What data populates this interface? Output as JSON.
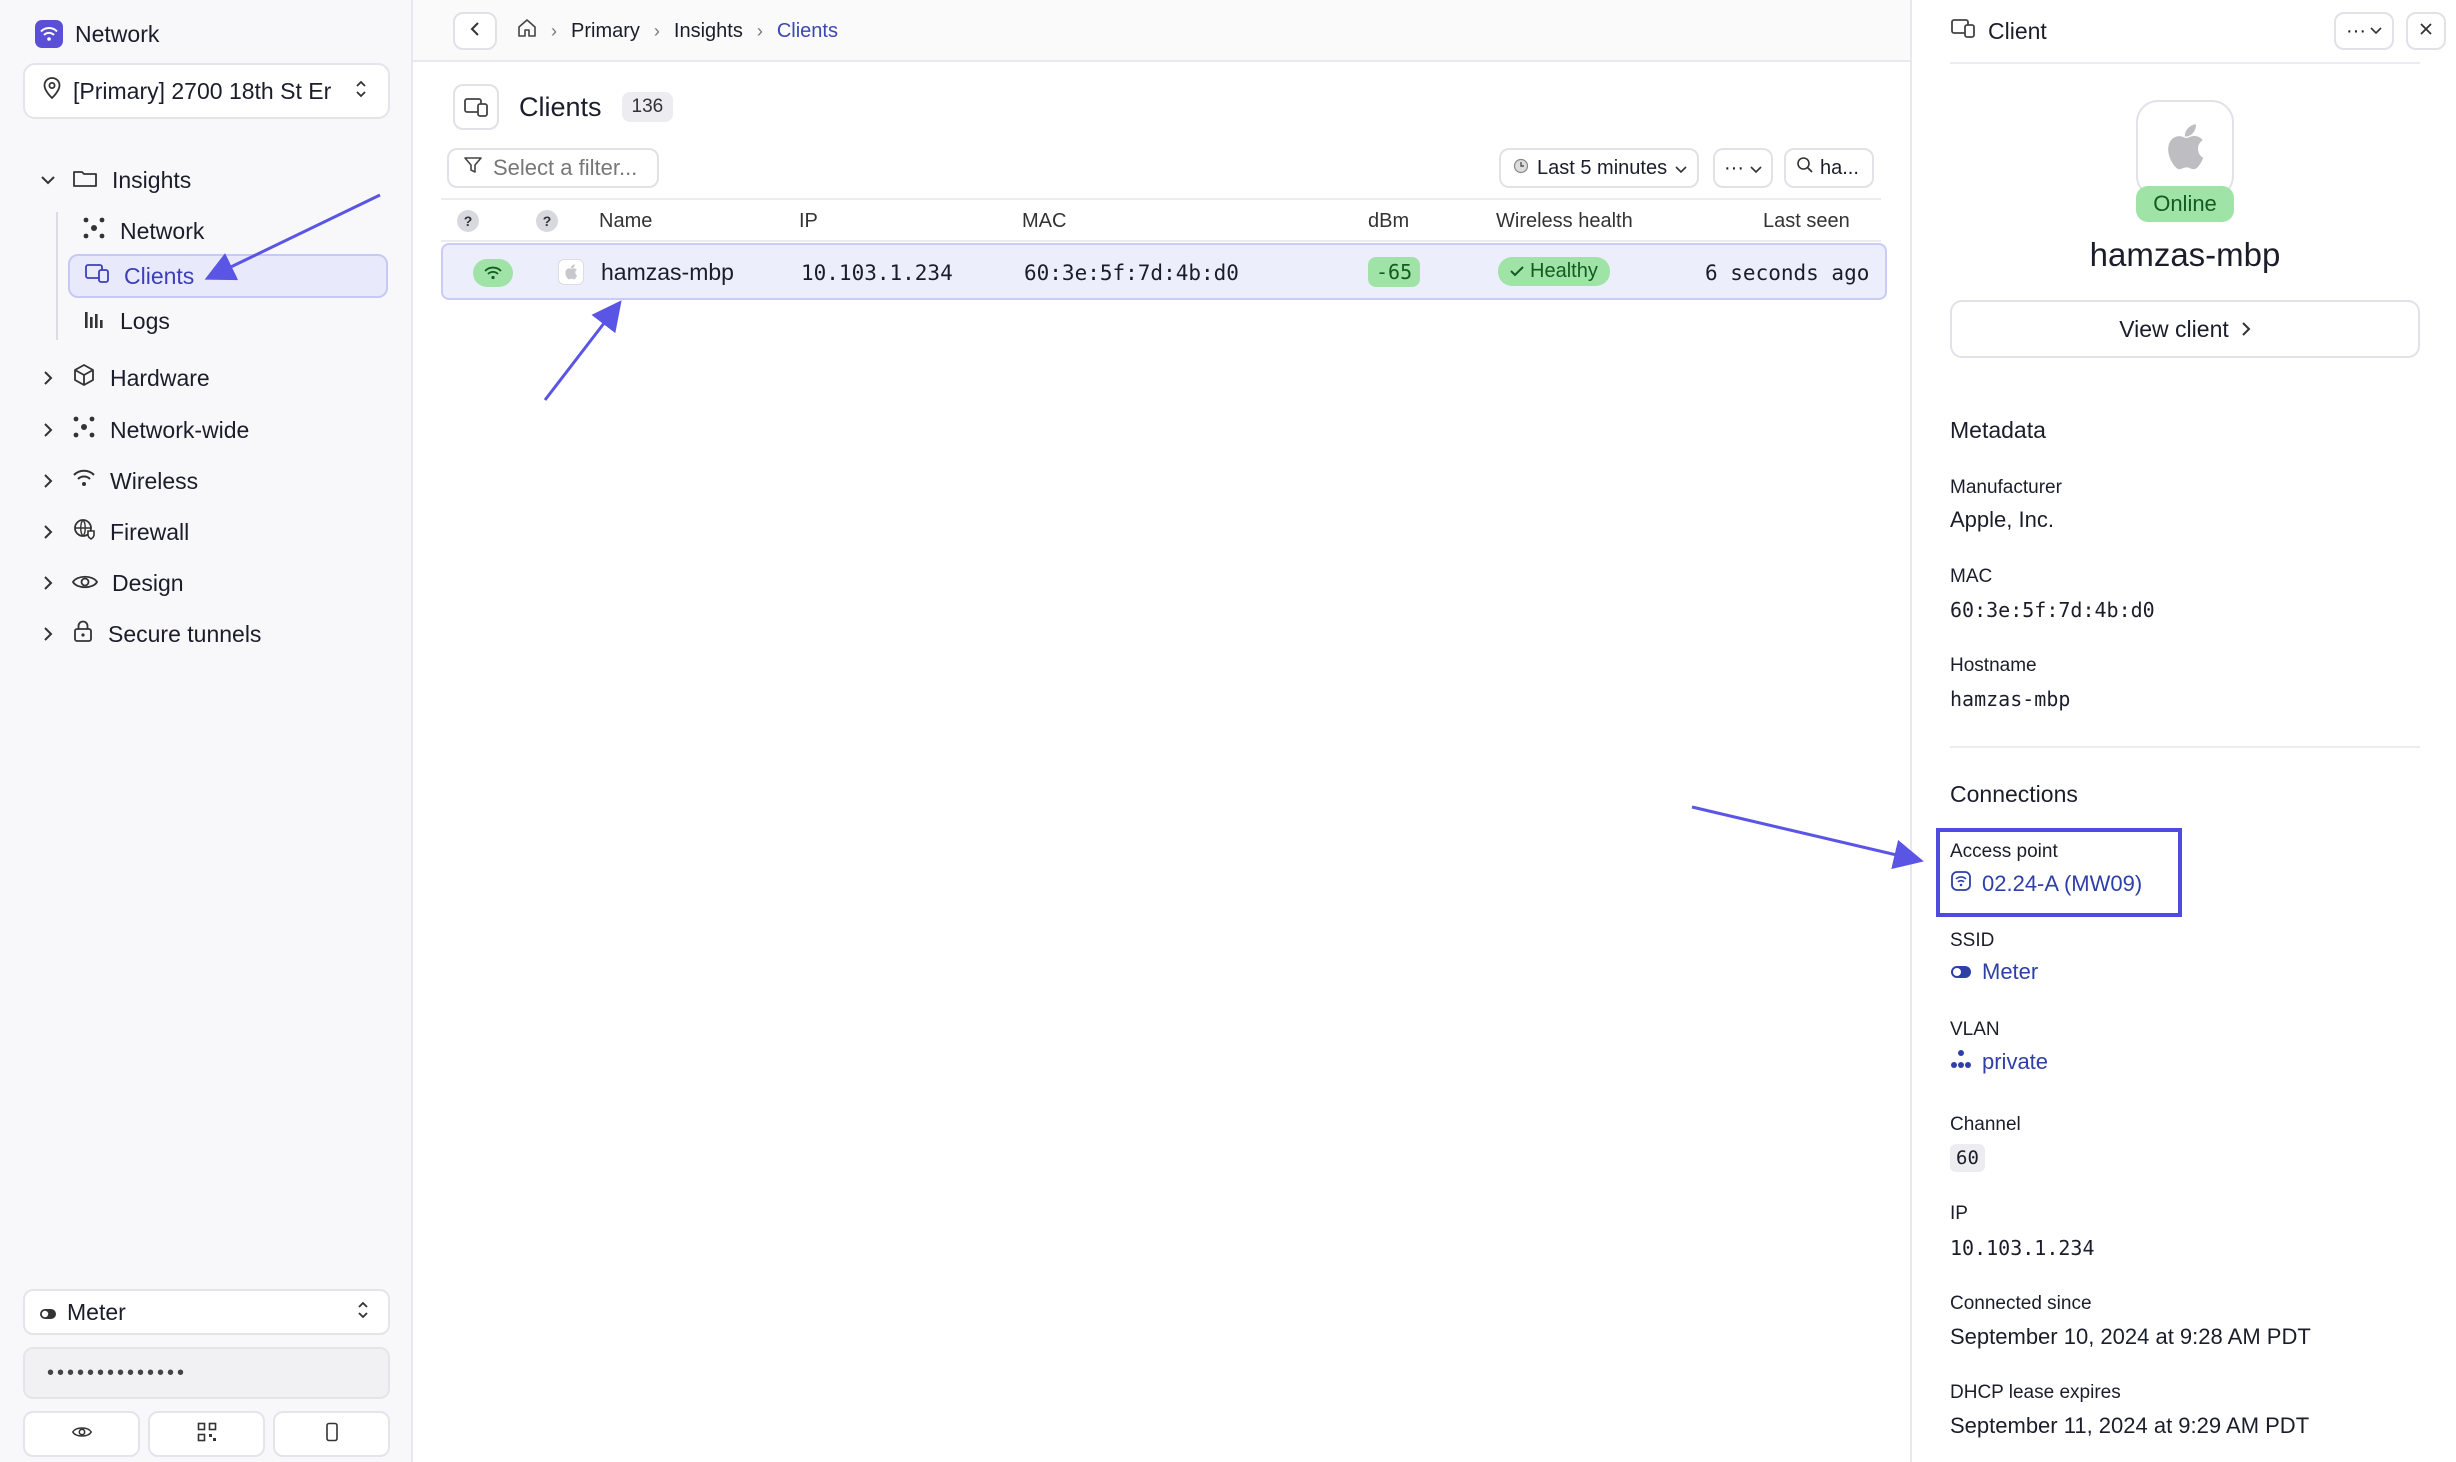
{
  "brand": {
    "name": "Network"
  },
  "location": {
    "selected": "[Primary] 2700 18th St Er"
  },
  "nav": {
    "insights": "Insights",
    "insights_children": [
      "Network",
      "Clients",
      "Logs"
    ],
    "items": [
      "Hardware",
      "Network-wide",
      "Wireless",
      "Firewall",
      "Design",
      "Secure tunnels"
    ]
  },
  "bottom": {
    "ssid_select": "Meter",
    "password_masked": "••••••••••••••"
  },
  "breadcrumb": [
    "Primary",
    "Insights",
    "Clients"
  ],
  "page": {
    "title": "Clients",
    "count": "136",
    "filter_placeholder": "Select a filter...",
    "time_range": "Last 5 minutes",
    "search_value": "ha..."
  },
  "table": {
    "headers": [
      "?",
      "?",
      "Name",
      "IP",
      "MAC",
      "dBm",
      "Wireless health",
      "Last seen"
    ],
    "rows": [
      {
        "name": "hamzas-mbp",
        "ip": "10.103.1.234",
        "mac": "60:3e:5f:7d:4b:d0",
        "dbm": "-65",
        "health": "Healthy",
        "last_seen": "6 seconds ago"
      }
    ]
  },
  "panel": {
    "title": "Client",
    "status": "Online",
    "client_name": "hamzas-mbp",
    "view_button": "View client",
    "metadata_title": "Metadata",
    "manufacturer_label": "Manufacturer",
    "manufacturer": "Apple, Inc.",
    "mac_label": "MAC",
    "mac": "60:3e:5f:7d:4b:d0",
    "hostname_label": "Hostname",
    "hostname": "hamzas-mbp",
    "connections_title": "Connections",
    "ap_label": "Access point",
    "ap": "02.24-A (MW09)",
    "ssid_label": "SSID",
    "ssid": "Meter",
    "vlan_label": "VLAN",
    "vlan": "private",
    "channel_label": "Channel",
    "channel": "60",
    "ip_label": "IP",
    "ip": "10.103.1.234",
    "connected_label": "Connected since",
    "connected": "September 10, 2024 at 9:28 AM PDT",
    "dhcp_label": "DHCP lease expires",
    "dhcp": "September 11, 2024 at 9:29 AM PDT"
  },
  "colors": {
    "accent": "#5a4fd6",
    "success": "#9fe3a6",
    "link": "#2f3fa8",
    "annotation": "#5b55e6"
  }
}
